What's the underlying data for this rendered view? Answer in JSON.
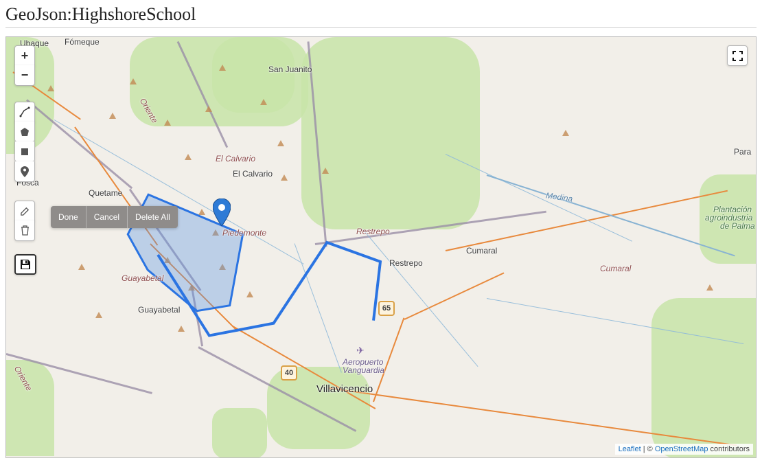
{
  "title": "GeoJson:HighshoreSchool",
  "controls": {
    "zoom_in": "+",
    "zoom_out": "−"
  },
  "delete_bar": {
    "done": "Done",
    "cancel": "Cancel",
    "delete_all": "Delete All"
  },
  "map_labels": {
    "ubaque": "Ubaque",
    "fomeque": "Fómeque",
    "san_juanito": "San Juanito",
    "el_calvario_it": "El Calvario",
    "el_calvario": "El Calvario",
    "quetame": "Quetame",
    "fosca": "Fosca",
    "piedemonte": "Piedemonte",
    "guayabetal_it": "Guayabetal",
    "guayabetal": "Guayabetal",
    "restrepo_it": "Restrepo",
    "restrepo": "Restrepo",
    "cumaral": "Cumaral",
    "cumaral2": "Cumaral",
    "para": "Para",
    "oriente": "Oriente",
    "oriente2": "Oriente",
    "medina": "Medina",
    "villavicencio": "Villavicencio",
    "aeropuerto": "Aeropuerto",
    "vanguardia": "Vanguardia",
    "plantacion1": "Plantación",
    "plantacion2": "agroindustria",
    "plantacion3": "de Palma"
  },
  "shields": {
    "r65": "65",
    "r40": "40"
  },
  "attribution": {
    "leaflet": "Leaflet",
    "sep": " | © ",
    "osm": "OpenStreetMap",
    "tail": " contributors"
  }
}
